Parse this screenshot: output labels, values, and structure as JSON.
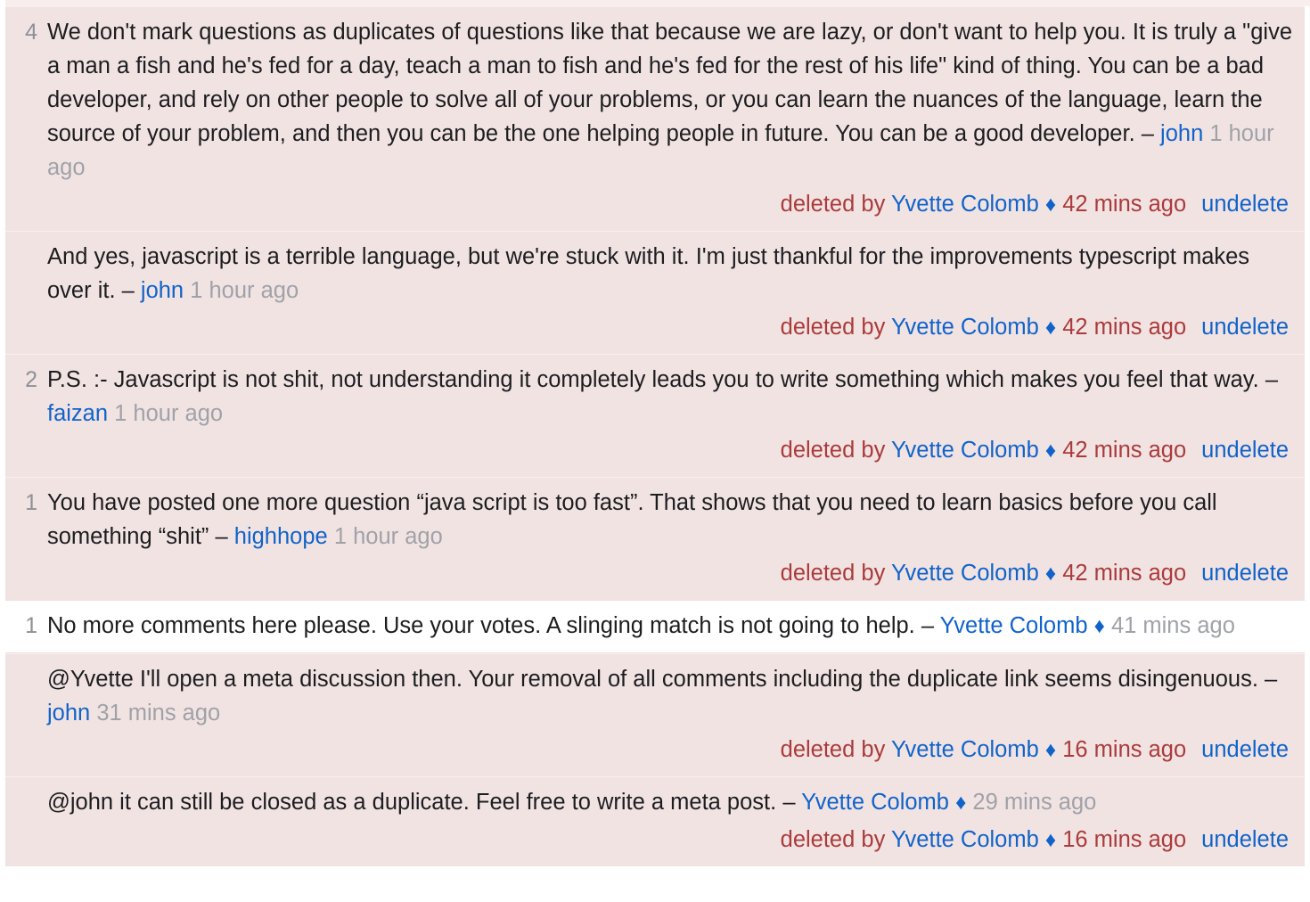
{
  "colors": {
    "deleted_background": "#f2e3e3",
    "normal_background": "#ffffff",
    "link_blue": "#1063c9",
    "deleted_red": "#ab3b3b",
    "date_grey": "#9fa2a8",
    "score_grey": "#8d9096",
    "text_black": "#1c1d1f"
  },
  "labels": {
    "deleted_by_prefix": "deleted by",
    "undelete": "undelete",
    "author_dash": "–",
    "mod_diamond": "♦"
  },
  "comments": [
    {
      "score": "4",
      "deleted": true,
      "text": "We don't mark questions as duplicates of questions like that because we are lazy, or don't want to help you. It is truly a \"give a man a fish and he's fed for a day, teach a man to fish and he's fed for the rest of his life\" kind of thing. You can be a bad developer, and rely on other people to solve all of your problems, or you can learn the nuances of the language, learn the source of your problem, and then you can be the one helping people in future. You can be a good developer.",
      "author": "john",
      "author_is_mod": false,
      "date": "1 hour ago",
      "deleted_by": "Yvette Colomb",
      "deleted_by_is_mod": true,
      "deleted_date": "42 mins ago"
    },
    {
      "score": "",
      "deleted": true,
      "text": "And yes, javascript is a terrible language, but we're stuck with it. I'm just thankful for the improvements typescript makes over it.",
      "author": "john",
      "author_is_mod": false,
      "date": "1 hour ago",
      "deleted_by": "Yvette Colomb",
      "deleted_by_is_mod": true,
      "deleted_date": "42 mins ago"
    },
    {
      "score": "2",
      "deleted": true,
      "text": "P.S. :- Javascript is not shit, not understanding it completely leads you to write something which makes you feel that way.",
      "author": "faizan",
      "author_is_mod": false,
      "date": "1 hour ago",
      "deleted_by": "Yvette Colomb",
      "deleted_by_is_mod": true,
      "deleted_date": "42 mins ago"
    },
    {
      "score": "1",
      "deleted": true,
      "text": "You have posted one more question “java script is too fast”. That shows that you need to learn basics before you call something “shit”",
      "author": "highhope",
      "author_is_mod": false,
      "date": "1 hour ago",
      "deleted_by": "Yvette Colomb",
      "deleted_by_is_mod": true,
      "deleted_date": "42 mins ago"
    },
    {
      "score": "1",
      "deleted": false,
      "text": "No more comments here please. Use your votes. A slinging match is not going to help.",
      "author": "Yvette Colomb",
      "author_is_mod": true,
      "date": "41 mins ago",
      "deleted_by": "",
      "deleted_by_is_mod": false,
      "deleted_date": ""
    },
    {
      "score": "",
      "deleted": true,
      "text": "@Yvette I'll open a meta discussion then. Your removal of all comments including the duplicate link seems disingenuous.",
      "author": "john",
      "author_is_mod": false,
      "date": "31 mins ago",
      "deleted_by": "Yvette Colomb",
      "deleted_by_is_mod": true,
      "deleted_date": "16 mins ago"
    },
    {
      "score": "",
      "deleted": true,
      "text": "@john it can still be closed as a duplicate. Feel free to write a meta post.",
      "author": "Yvette Colomb",
      "author_is_mod": true,
      "date": "29 mins ago",
      "deleted_by": "Yvette Colomb",
      "deleted_by_is_mod": true,
      "deleted_date": "16 mins ago"
    }
  ]
}
